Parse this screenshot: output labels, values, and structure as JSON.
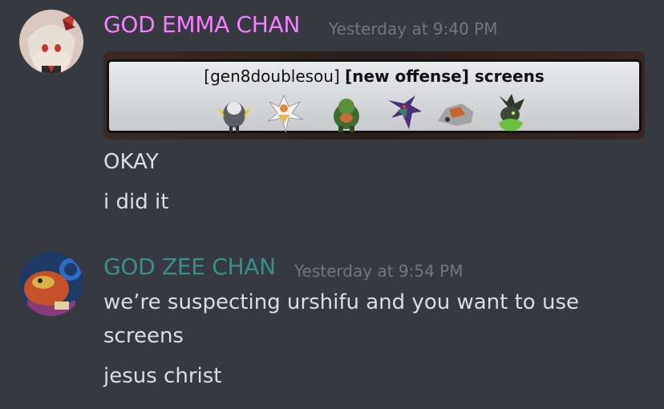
{
  "messages": [
    {
      "username": "GOD EMMA CHAN",
      "username_color": "#f47fff",
      "timestamp": "Yesterday at 9:40 PM",
      "embed": {
        "format": "[gen8doublesou]",
        "title": "[new offense] screens",
        "sprites": [
          "pokemon-sprite-1",
          "pokemon-sprite-2",
          "pokemon-sprite-3",
          "pokemon-sprite-4",
          "pokemon-sprite-5",
          "pokemon-sprite-6"
        ]
      },
      "lines": [
        "OKAY",
        "i did it"
      ]
    },
    {
      "username": "GOD ZEE CHAN",
      "username_color": "#3b8f8a",
      "timestamp": "Yesterday at 9:54 PM",
      "lines": [
        "we’re suspecting urshifu and you want to use",
        "screens",
        "jesus christ"
      ]
    }
  ]
}
